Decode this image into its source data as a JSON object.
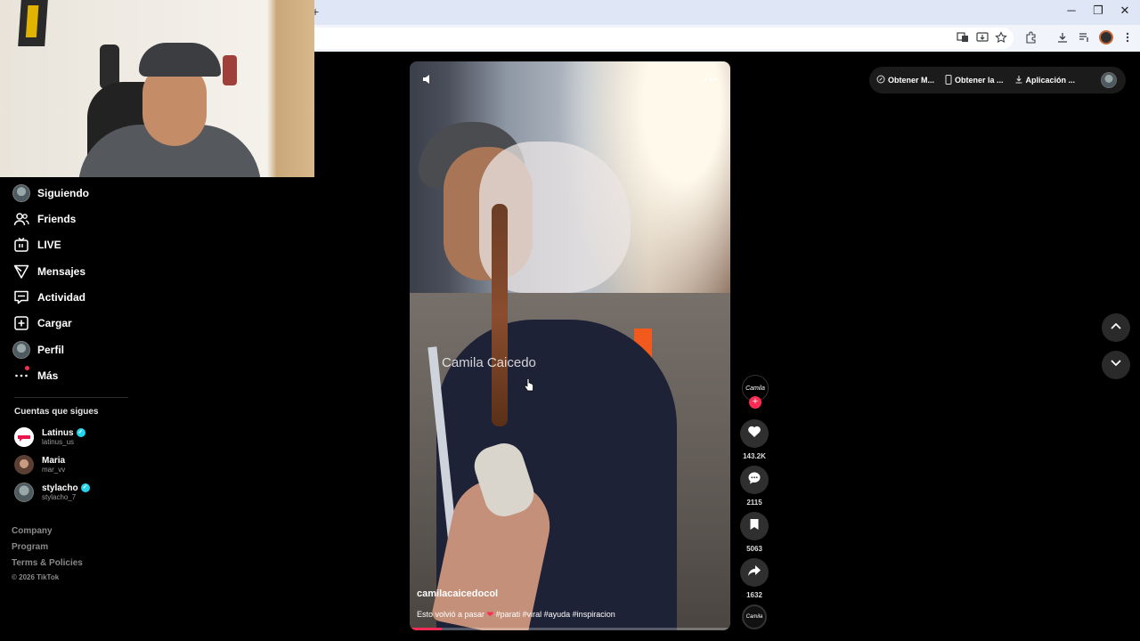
{
  "browser": {
    "new_tab_glyph": "+",
    "window_controls": [
      "─",
      "❐",
      "✕"
    ],
    "toolbar_icons": [
      "translate-icon",
      "install-app-icon",
      "bookmark-star-icon",
      "extensions-icon",
      "download-icon",
      "media-control-icon",
      "profile-avatar",
      "kebab-menu-icon"
    ]
  },
  "sidebar": {
    "nav": [
      {
        "label": "Siguiendo",
        "icon": "avatar"
      },
      {
        "label": "Friends",
        "icon": "friends-icon"
      },
      {
        "label": "LIVE",
        "icon": "live-icon"
      },
      {
        "label": "Mensajes",
        "icon": "messages-icon"
      },
      {
        "label": "Actividad",
        "icon": "activity-icon"
      },
      {
        "label": "Cargar",
        "icon": "upload-icon"
      },
      {
        "label": "Perfil",
        "icon": "avatar"
      },
      {
        "label": "Más",
        "icon": "more-icon"
      }
    ],
    "following_title": "Cuentas que sigues",
    "accounts": [
      {
        "name": "Latinus",
        "handle": "latinus_us",
        "verified": true,
        "color": "#e8144a"
      },
      {
        "name": "Maria",
        "handle": "mar_vv",
        "verified": false,
        "color": "#8a5e4c"
      },
      {
        "name": "stylacho",
        "handle": "stylacho_7",
        "verified": true,
        "color": "#5d6d72"
      }
    ],
    "footer": [
      "Company",
      "Program",
      "Terms & Policies"
    ],
    "copyright": "© 2026 TikTok"
  },
  "video": {
    "author": "camilacaicedocol",
    "caption_text": "Esto volvió a pasar",
    "caption_heart": "❤",
    "hashtags": "#parati #viral #ayuda #inspiracion",
    "watermark": "Camila Caicedo",
    "progress": 0.1
  },
  "actions": {
    "creator_logo": "Camila",
    "likes": "143.2K",
    "comments": "2115",
    "saves": "5063",
    "shares": "1632",
    "sound_logo": "Camila"
  },
  "top_pill": {
    "buttons": [
      "Obtener M...",
      "Obtener la ...",
      "Aplicación ..."
    ]
  },
  "colors": {
    "accent": "#fe2c55",
    "verified": "#20d5ec",
    "background": "#000000"
  }
}
